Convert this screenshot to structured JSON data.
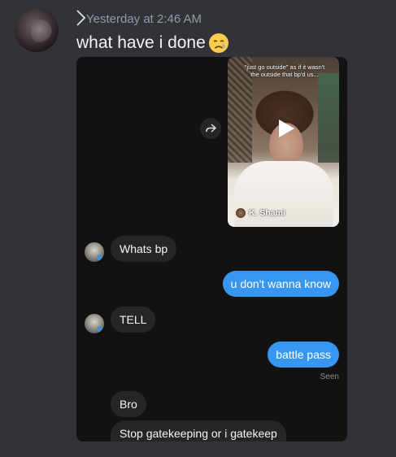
{
  "message": {
    "timestamp": "Yesterday at 2:46 AM",
    "text": "what have i done",
    "emoji": "sad-relieved-face-emoji"
  },
  "screenshot": {
    "video": {
      "caption": "\"just go outside\" as if it wasn't the outside that bp'd us...",
      "creator": "K. Shami"
    },
    "chat": {
      "messages": [
        {
          "from": "them",
          "text": "Whats bp"
        },
        {
          "from": "me",
          "text": "u don't wanna know"
        },
        {
          "from": "them",
          "text": "TELL"
        },
        {
          "from": "me",
          "text": "battle pass"
        },
        {
          "from": "them",
          "text": "Bro"
        },
        {
          "from": "them",
          "text": "Stop gatekeeping or i gatekeep"
        }
      ],
      "seen_label": "Seen"
    }
  },
  "colors": {
    "background": "#313338",
    "attachment_bg": "#121212",
    "bubble_in": "#262626",
    "bubble_out": "#3797f0",
    "timestamp": "#949ba4"
  }
}
